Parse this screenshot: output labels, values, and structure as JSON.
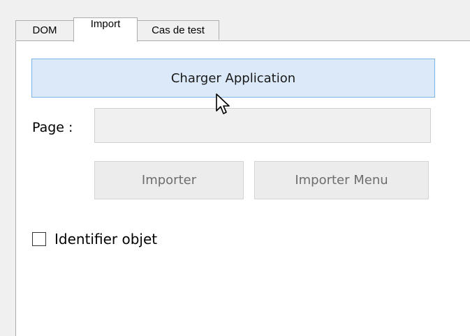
{
  "tabs": [
    {
      "label": "DOM"
    },
    {
      "label": "Import",
      "active": true
    },
    {
      "label": "Cas de test"
    }
  ],
  "import_panel": {
    "charger_button_label": "Charger Application",
    "page_label": "Page :",
    "page_input_value": "",
    "importer_button_label": "Importer",
    "importer_menu_button_label": "Importer Menu",
    "identifier_checkbox_label": "Identifier objet",
    "identifier_checked": false
  },
  "colors": {
    "highlight_button_bg": "#dbe9f8",
    "highlight_button_border": "#7eb4ea",
    "window_bg": "#f0f0f0",
    "panel_bg": "#ffffff"
  },
  "cursor_icon": "arrow-pointer-icon"
}
